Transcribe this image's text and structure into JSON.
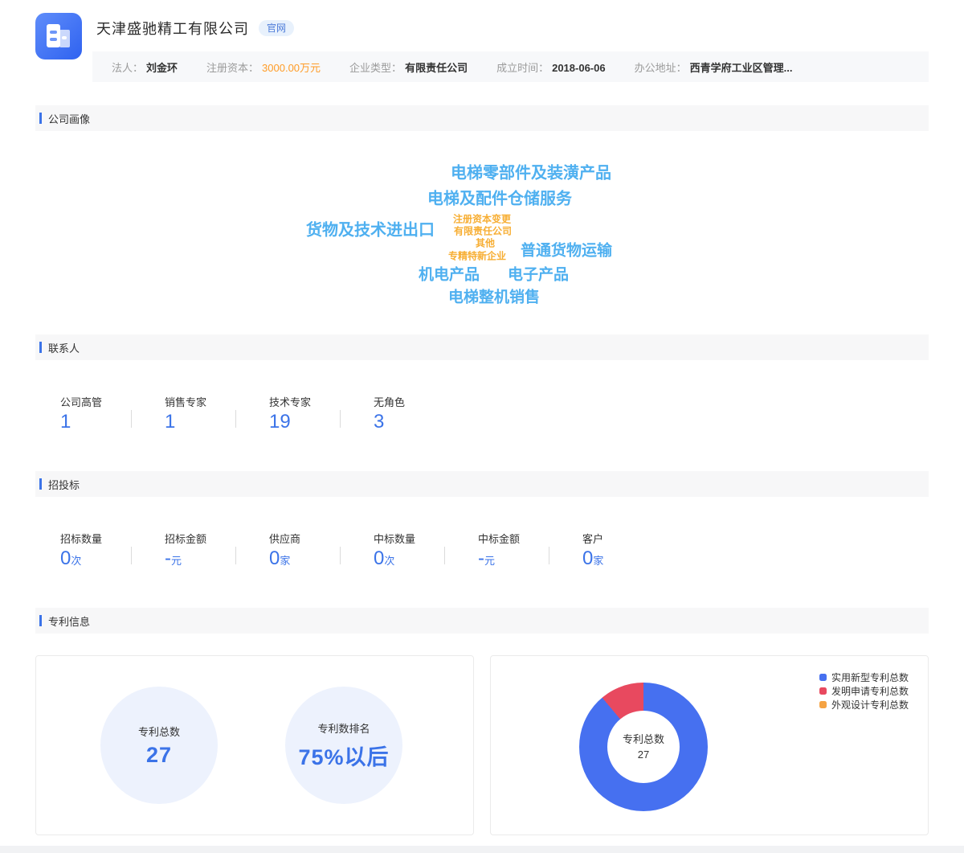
{
  "colors": {
    "primary_blue": "#3B73E8",
    "wordcloud_blue": "#4FB0F0",
    "wordcloud_orange": "#F7AE33",
    "capital_orange": "#FF9C27",
    "section_bar_blue": "#3B73E8"
  },
  "header": {
    "company_name": "天津盛驰精工有限公司",
    "badge": "官网",
    "info": [
      {
        "label": "法人：",
        "value": "刘金环"
      },
      {
        "label": "注册资本：",
        "value": "3000.00万元",
        "value_color": "#FF9C27"
      },
      {
        "label": "企业类型：",
        "value": "有限责任公司"
      },
      {
        "label": "成立时间：",
        "value": "2018-06-06"
      },
      {
        "label": "办公地址：",
        "value": "西青学府工业区管理..."
      }
    ]
  },
  "sections": {
    "portrait_title": "公司画像",
    "contacts_title": "联系人",
    "bidding_title": "招投标",
    "patents_title": "专利信息"
  },
  "word_cloud": [
    {
      "text": "电梯零部件及装潢产品",
      "color": "#4FB0F0"
    },
    {
      "text": "电梯及配件仓储服务",
      "color": "#4FB0F0"
    },
    {
      "text": "货物及技术进出口",
      "color": "#4FB0F0"
    },
    {
      "text": "注册资本变更",
      "color": "#F7AE33"
    },
    {
      "text": "有限责任公司",
      "color": "#F7AE33"
    },
    {
      "text": "其他",
      "color": "#F7AE33"
    },
    {
      "text": "专精特新企业",
      "color": "#F7AE33"
    },
    {
      "text": "普通货物运输",
      "color": "#4FB0F0"
    },
    {
      "text": "机电产品",
      "color": "#4FB0F0"
    },
    {
      "text": "电子产品",
      "color": "#4FB0F0"
    },
    {
      "text": "电梯整机销售",
      "color": "#4FB0F0"
    }
  ],
  "contacts": {
    "stats": [
      {
        "label": "公司高管",
        "value": "1",
        "unit": ""
      },
      {
        "label": "销售专家",
        "value": "1",
        "unit": ""
      },
      {
        "label": "技术专家",
        "value": "19",
        "unit": ""
      },
      {
        "label": "无角色",
        "value": "3",
        "unit": ""
      }
    ]
  },
  "bidding": {
    "stats": [
      {
        "label": "招标数量",
        "value": "0",
        "unit": "次"
      },
      {
        "label": "招标金额",
        "value": "-",
        "unit": "元"
      },
      {
        "label": "供应商",
        "value": "0",
        "unit": "家"
      },
      {
        "label": "中标数量",
        "value": "0",
        "unit": "次"
      },
      {
        "label": "中标金额",
        "value": "-",
        "unit": "元"
      },
      {
        "label": "客户",
        "value": "0",
        "unit": "家"
      }
    ]
  },
  "patents": {
    "total_label": "专利总数",
    "total_value": "27",
    "rank_label": "专利数排名",
    "rank_value": "75%以后"
  },
  "chart_data": {
    "type": "pie",
    "donut": true,
    "center_label": "专利总数",
    "center_value": "27",
    "total": 27,
    "legend_position": "top-right",
    "series": [
      {
        "name": "实用新型专利总数",
        "value": 24,
        "color": "#4670F0"
      },
      {
        "name": "发明申请专利总数",
        "value": 3,
        "color": "#E8495F"
      },
      {
        "name": "外观设计专利总数",
        "value": 0,
        "color": "#F5A343"
      }
    ]
  }
}
